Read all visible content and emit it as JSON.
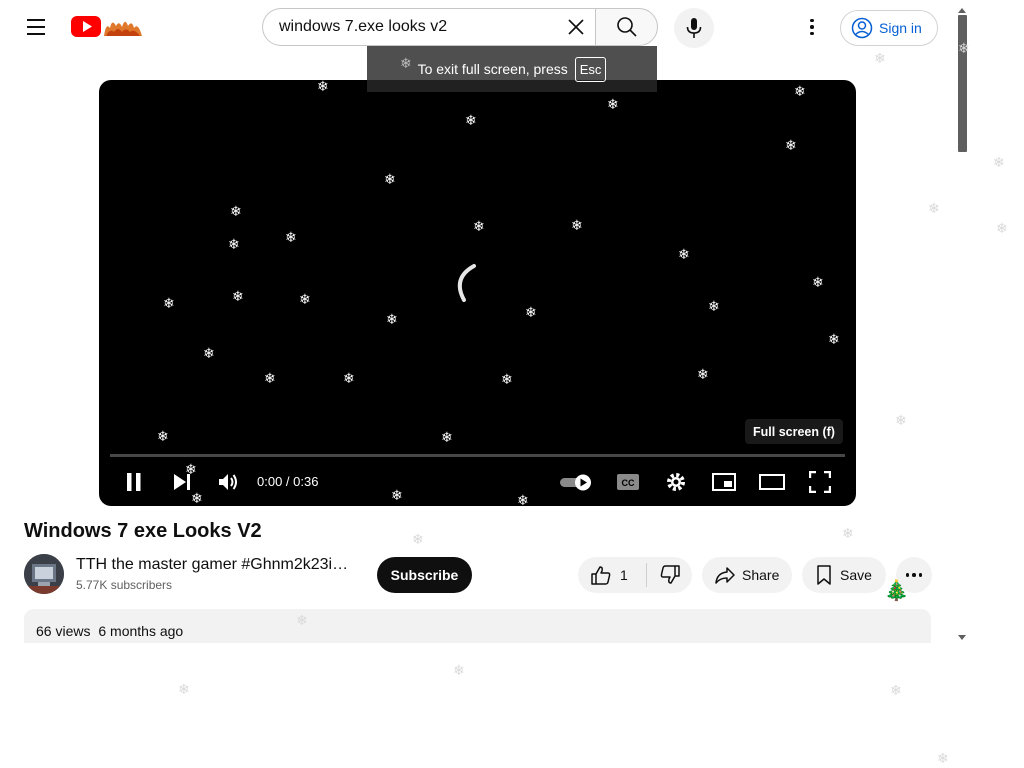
{
  "header": {
    "search_value": "windows 7.exe looks v2",
    "signin_label": "Sign in",
    "logo_icon": "youtube-logo"
  },
  "fullscreen_toast": {
    "text": "To exit full screen, press",
    "key": "Esc"
  },
  "player": {
    "time": "0:00 / 0:36",
    "tooltip": "Full screen (f)",
    "progress": 0
  },
  "video": {
    "title": "Windows 7 exe Looks V2",
    "channel_name": "TTH the master gamer #Ghnm2k23i…",
    "subscribers": "5.77K subscribers",
    "subscribe_label": "Subscribe",
    "likes": "1",
    "share_label": "Share",
    "save_label": "Save",
    "views": "66 views",
    "age": "6 months ago"
  },
  "colors": {
    "accent_blue": "#065fd4",
    "youtube_red": "#ff0000",
    "button_dark": "#0f0f0f",
    "chip_gray": "#f2f2f2"
  }
}
